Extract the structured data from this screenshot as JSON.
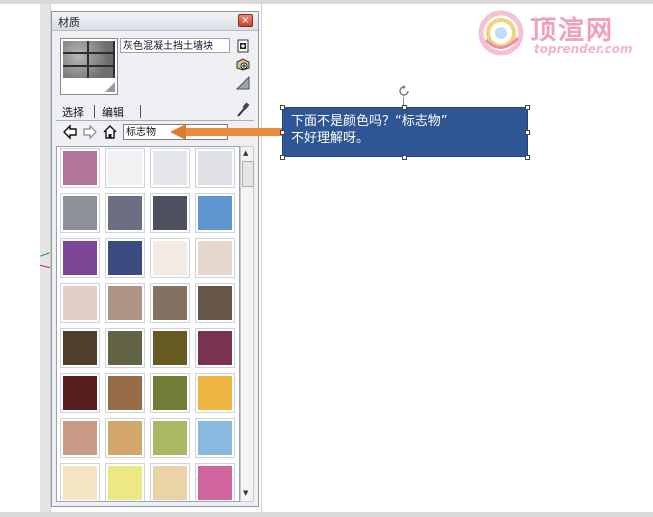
{
  "logo": {
    "chinese": "顶渲网",
    "english": "toprender.com"
  },
  "panel": {
    "title": "材质",
    "close_label": "×",
    "material_name": "灰色混凝土挡土墙块",
    "tabs": [
      {
        "label": "选择"
      },
      {
        "label": "编辑"
      }
    ],
    "library_selected": "标志物"
  },
  "callout": {
    "line1": "下面不是颜色吗？“标志物”",
    "line2": "不好理解呀。"
  },
  "swatches": [
    "#b27597",
    "#f1f1f3",
    "#e6e7ea",
    "#e0e1e4",
    "#8d9096",
    "#6c6f84",
    "#4d505e",
    "#6096cf",
    "#7a4695",
    "#3b4b80",
    "#f4ebe6",
    "#e6d8cd",
    "#e1d0c5",
    "#ae9484",
    "#857162",
    "#665549",
    "#4f3f2c",
    "#636446",
    "#665a20",
    "#7a3350",
    "#571e20",
    "#976b45",
    "#6f7d36",
    "#f0b643",
    "#cb9a86",
    "#d3a66c",
    "#a9b865",
    "#89b9de",
    "#f5e4c1",
    "#ece884",
    "#ecd3a5",
    "#d0649e"
  ],
  "colors": {
    "callout_bg": "#2e5594",
    "arrow": "#e98a3c"
  }
}
